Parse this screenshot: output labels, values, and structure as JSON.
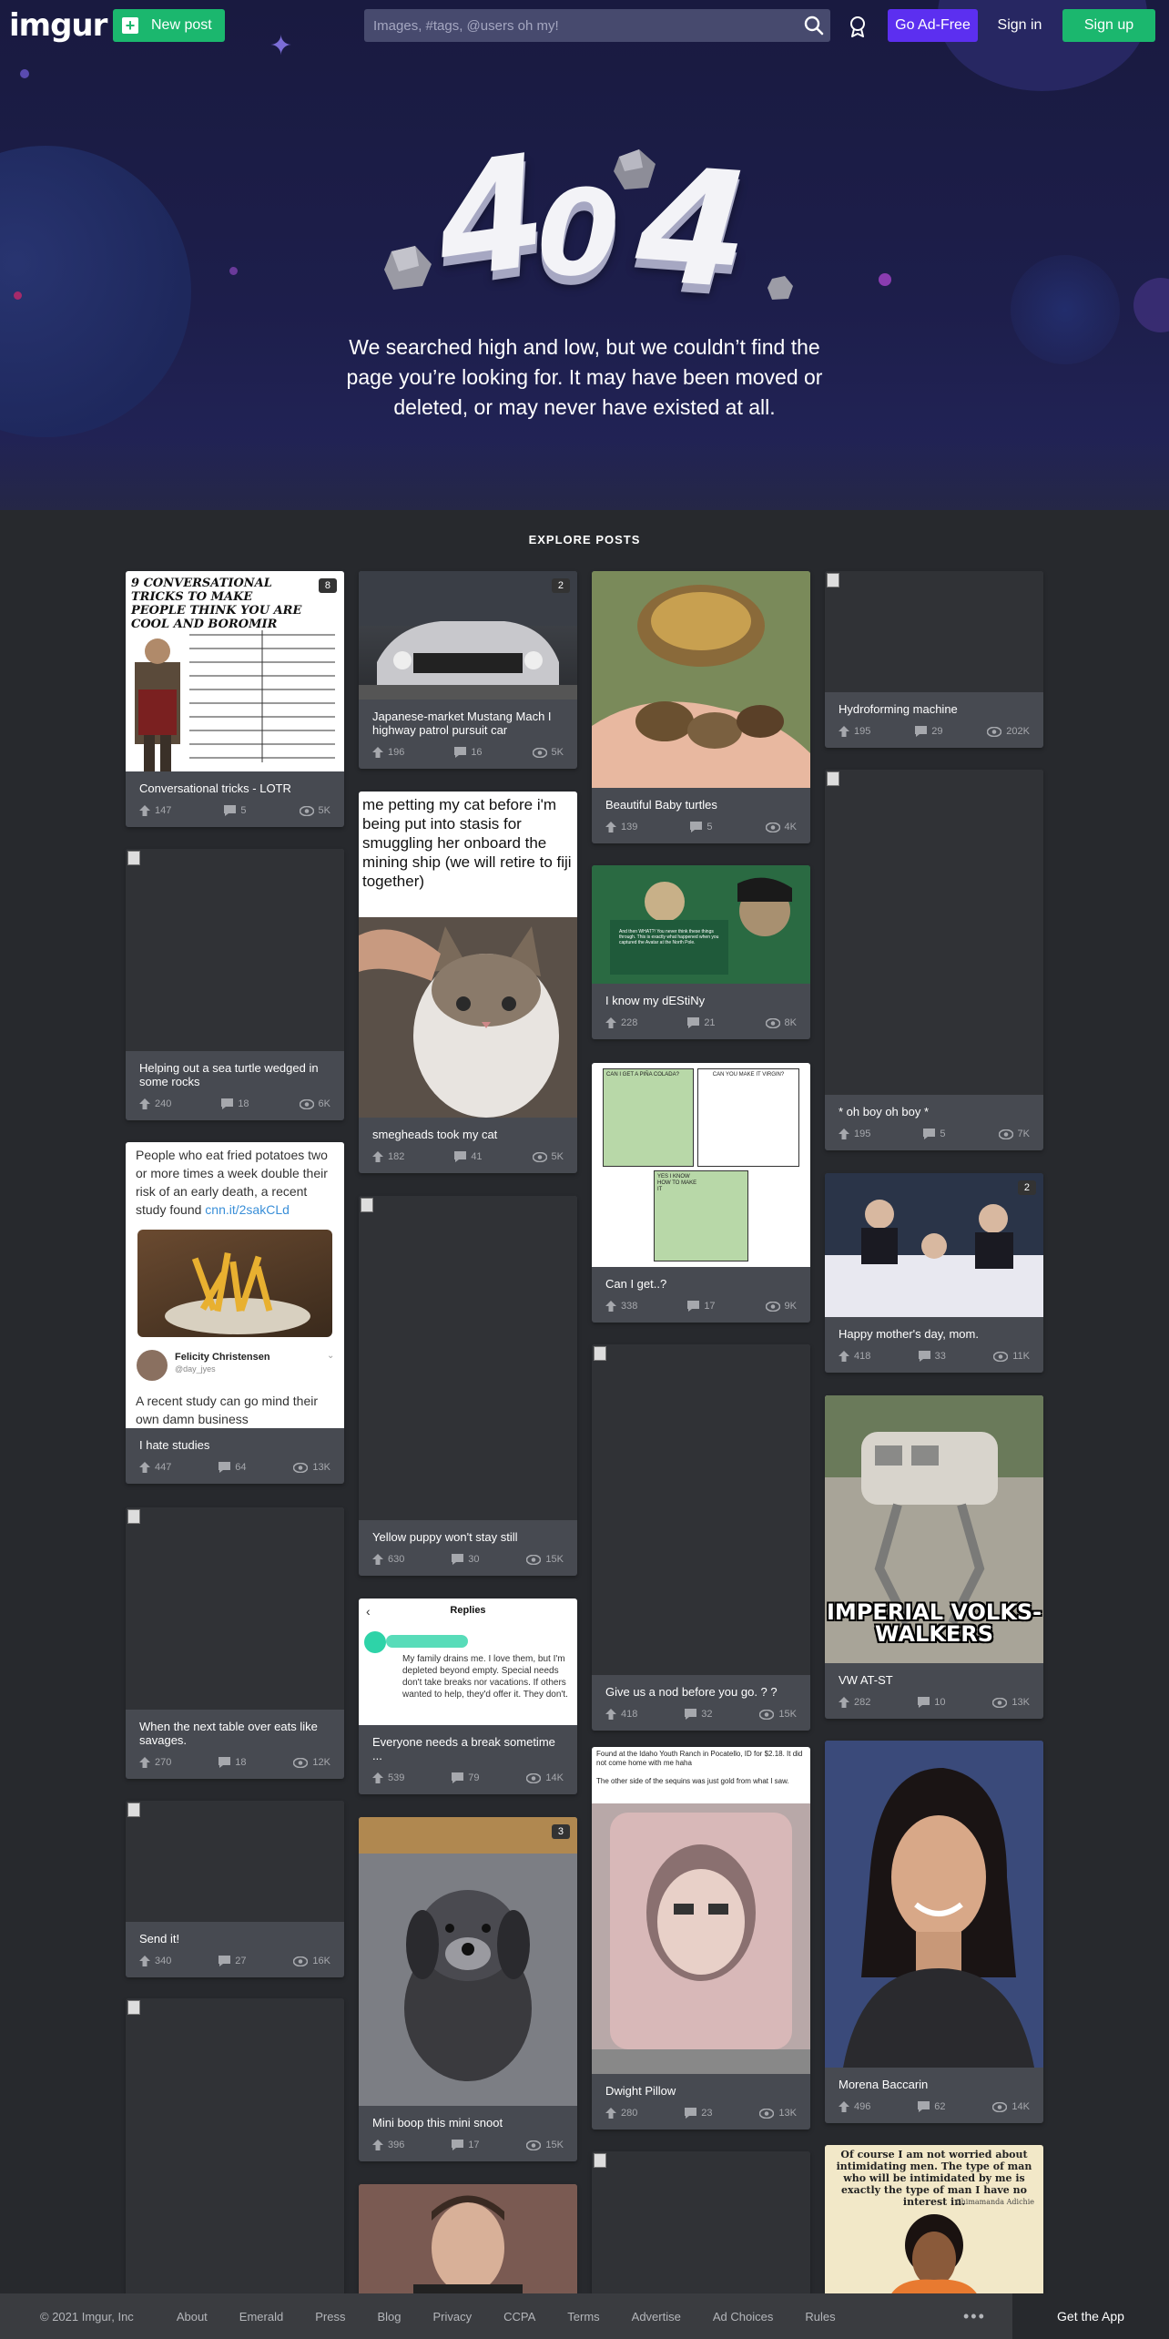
{
  "header": {
    "logo": "imgur",
    "new_post": "New post",
    "search_placeholder": "Images, #tags, @users oh my!",
    "go_ad_free": "Go Ad-Free",
    "sign_in": "Sign in",
    "sign_up": "Sign up"
  },
  "hero": {
    "code": "404",
    "message": "We searched high and low, but we couldn’t find the page you’re looking for. It may have been moved or deleted, or may never have existed at all."
  },
  "explore_label": "EXPLORE POSTS",
  "posts": [
    {
      "title": "Conversational tricks - LOTR",
      "up": "147",
      "comments": "5",
      "views": "5K",
      "count": "8"
    },
    {
      "title": "Helping out a sea turtle wedged in some rocks",
      "up": "240",
      "comments": "18",
      "views": "6K"
    },
    {
      "title": "I hate studies",
      "up": "447",
      "comments": "64",
      "views": "13K"
    },
    {
      "title": "When the next table over eats like savages.",
      "up": "270",
      "comments": "18",
      "views": "12K"
    },
    {
      "title": "Send it!",
      "up": "340",
      "comments": "27",
      "views": "16K"
    },
    {
      "title": "Japanese-market Mustang Mach I highway patrol pursuit car",
      "up": "196",
      "comments": "16",
      "views": "5K",
      "count": "2"
    },
    {
      "title": "smegheads took my cat",
      "up": "182",
      "comments": "41",
      "views": "5K"
    },
    {
      "title": "Yellow puppy won't stay still",
      "up": "630",
      "comments": "30",
      "views": "15K"
    },
    {
      "title": "Everyone needs a break sometime ...",
      "up": "539",
      "comments": "79",
      "views": "14K"
    },
    {
      "title": "Mini boop this mini snoot",
      "up": "396",
      "comments": "17",
      "views": "15K",
      "count": "3"
    },
    {
      "title": "Beautiful Baby turtles",
      "up": "139",
      "comments": "5",
      "views": "4K"
    },
    {
      "title": "I know my dEStiNy",
      "up": "228",
      "comments": "21",
      "views": "8K"
    },
    {
      "title": "Can I get..?",
      "up": "338",
      "comments": "17",
      "views": "9K"
    },
    {
      "title": "Give us a nod before you go. ? ?",
      "up": "418",
      "comments": "32",
      "views": "15K"
    },
    {
      "title": "Dwight Pillow",
      "up": "280",
      "comments": "23",
      "views": "13K"
    },
    {
      "title": "Hydroforming machine",
      "up": "195",
      "comments": "29",
      "views": "202K"
    },
    {
      "title": "* oh boy oh boy *",
      "up": "195",
      "comments": "5",
      "views": "7K"
    },
    {
      "title": "Happy mother's day, mom.",
      "up": "418",
      "comments": "33",
      "views": "11K",
      "count": "2"
    },
    {
      "title": "VW AT-ST",
      "up": "282",
      "comments": "10",
      "views": "13K"
    },
    {
      "title": "Morena Baccarin",
      "up": "496",
      "comments": "62",
      "views": "14K"
    }
  ],
  "image_text": {
    "boromir_title": "9 CONVERSATIONAL TRICKS TO MAKE PEOPLE THINK YOU ARE COOL AND BOROMIR",
    "cat_caption": "me petting my cat before i'm being put into stasis for smuggling her onboard the mining ship (we will retire to fiji together)",
    "fries_text": "People who eat fried potatoes two or more times a week double their risk of an early death, a recent study found",
    "fries_link": "cnn.it/2sakCLd",
    "fries_user": "Felicity Christensen",
    "fries_handle": "@day_jyes",
    "fries_bottom": "A recent study can go mind their own damn business",
    "replies_header": "Replies",
    "replies_text": "My family drains me. I love them, but I'm depleted beyond empty. Special needs don't take breaks nor vacations. If others wanted to help, they'd offer it. They don't.",
    "pillow_caption": "Found at the Idaho Youth Ranch in Pocatello, ID for $2.18. It did not come home with me haha\n\nThe other side of the sequins was just gold from what I saw.",
    "volks_caption": "IMPERIAL VOLKS-WALKERS",
    "quote_text": "Of course I am not worried about intimidating men. The type of man who will be intimidated by me is exactly the type of man I have no interest in.",
    "quote_author": "Chimamanda Adichie",
    "comic_text": "And then WHAT?! You never think these things through. This is exactly what happened when you captured the Avatar at the North Pole.",
    "comic2_a": "CAN I GET A PIÑA COLADA?",
    "comic2_b": "CAN YOU MAKE IT VIRGIN?",
    "comic2_c": "YES I KNOW HOW TO MAKE IT"
  },
  "footer": {
    "copyright": "© 2021 Imgur, Inc",
    "links": [
      "About",
      "Emerald",
      "Press",
      "Blog",
      "Privacy",
      "CCPA",
      "Terms",
      "Advertise",
      "Ad Choices",
      "Rules"
    ],
    "more": "•••",
    "get_app": "Get the App"
  }
}
